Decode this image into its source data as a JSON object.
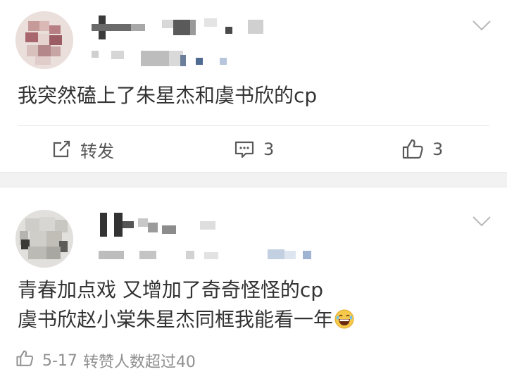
{
  "feed": {
    "post": {
      "text": "我突然磕上了朱星杰和虞书欣的cp",
      "actions": {
        "repost_label": "转发",
        "comment_count": "3",
        "like_count": "3"
      },
      "icons": {
        "repost": "repost-icon",
        "comment": "comment-icon",
        "like": "thumb-up-icon",
        "menu": "chevron-down-icon"
      }
    },
    "comment": {
      "line1": "青春加点戏 又增加了奇奇怪怪的cp",
      "line2": "虞书欣赵小棠朱星杰同框我能看一年",
      "emoji": "grinning-tears-emoji",
      "date": "5-17",
      "status": "转赞人数超过40",
      "icons": {
        "like": "thumb-up-icon",
        "menu": "chevron-down-icon"
      }
    }
  }
}
